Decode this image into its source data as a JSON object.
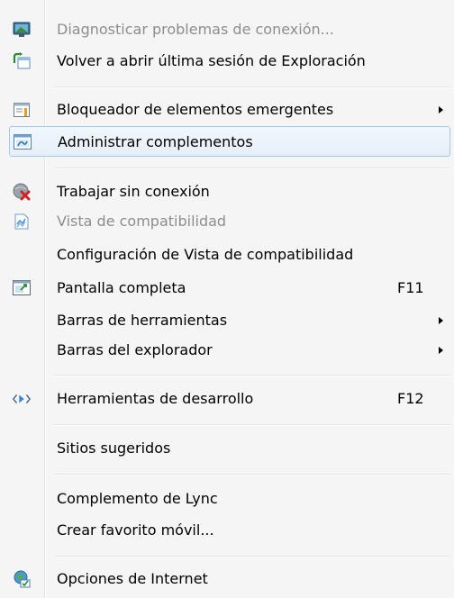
{
  "menu": {
    "items": [
      {
        "label": "Diagnosticar problemas de conexión...",
        "icon": "network-diagnose-icon",
        "disabled": true
      },
      {
        "label": "Volver a abrir última sesión de Exploración",
        "icon": "reopen-session-icon"
      },
      {
        "label": "Bloqueador de elementos emergentes",
        "icon": "popup-blocker-icon",
        "submenu": true
      },
      {
        "label": "Administrar complementos",
        "icon": "manage-addons-icon",
        "highlighted": true
      },
      {
        "label": "Trabajar sin conexión",
        "icon": "work-offline-icon"
      },
      {
        "label": "Vista de compatibilidad",
        "icon": "compatibility-view-icon",
        "disabled": true
      },
      {
        "label": "Configuración de Vista de compatibilidad"
      },
      {
        "label": "Pantalla completa",
        "icon": "full-screen-icon",
        "shortcut": "F11"
      },
      {
        "label": "Barras de herramientas",
        "submenu": true
      },
      {
        "label": "Barras del explorador",
        "submenu": true
      },
      {
        "label": "Herramientas de desarrollo",
        "icon": "developer-tools-icon",
        "shortcut": "F12"
      },
      {
        "label": "Sitios sugeridos"
      },
      {
        "label": "Complemento de Lync"
      },
      {
        "label": "Crear favorito móvil..."
      },
      {
        "label": "Opciones de Internet",
        "icon": "internet-options-icon"
      }
    ]
  },
  "colors": {
    "menu_background": "#f5f5f5",
    "highlight_border": "#a8c8ea",
    "disabled_text": "#8d8d8d"
  }
}
